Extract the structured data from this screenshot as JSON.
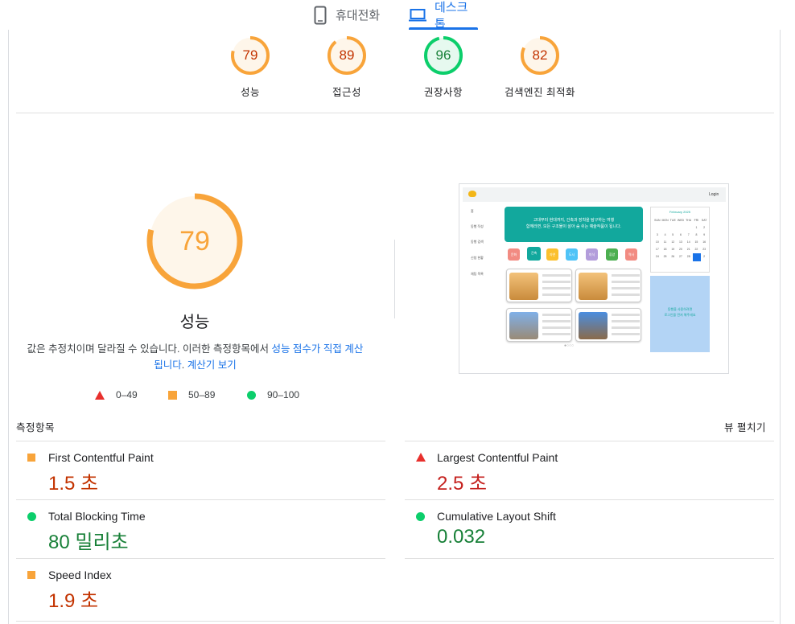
{
  "tabs": {
    "mobile": {
      "label": "휴대전화",
      "icon": "smartphone-icon"
    },
    "desktop": {
      "label": "데스크톱",
      "icon": "laptop-icon",
      "active": true
    }
  },
  "colors": {
    "accent": "#1a73e8",
    "average": "#f8a43a",
    "average_text": "#c33300",
    "pass": "#0cce6b",
    "pass_text": "#188038",
    "fail": "#e8302d",
    "fail_text": "#c5221f"
  },
  "gauges": [
    {
      "score": "79",
      "label": "성능",
      "status": "average"
    },
    {
      "score": "89",
      "label": "접근성",
      "status": "average"
    },
    {
      "score": "96",
      "label": "권장사항",
      "status": "pass"
    },
    {
      "score": "82",
      "label": "검색엔진 최적화",
      "status": "average"
    }
  ],
  "performance": {
    "score": "79",
    "title": "성능",
    "desc_prefix": "값은 추정치이며 달라질 수 있습니다. 이러한 측정항목에서 ",
    "desc_link1": "성능 점수가 직접 계산됩니다",
    "desc_mid": ". ",
    "desc_link2": "계산기 보기"
  },
  "legend": [
    {
      "shape": "triangle",
      "range": "0–49"
    },
    {
      "shape": "square",
      "range": "50–89"
    },
    {
      "shape": "circle",
      "range": "90–100"
    }
  ],
  "screenshot": {
    "login": "Login",
    "side_items": [
      "홈",
      "동행 작성",
      "동행 검색",
      "신청 현황",
      "채팅 목록"
    ],
    "hero_line1": "고대부터 현대까지, 건축과 장착을 탐구하는 여행",
    "hero_line2": "함께라면, 모든 구조물이 살아 숨 쉬는 예술작품이 됩니다.",
    "chips": [
      "문화",
      "건축",
      "자연",
      "도시",
      "미식",
      "휴양",
      "역사"
    ],
    "calendar_title": "February 2025",
    "calendar_days": [
      "SUN",
      "MON",
      "TUE",
      "WED",
      "THU",
      "FRI",
      "SAT",
      "",
      "",
      "",
      "",
      "",
      "1",
      "2",
      "3",
      "4",
      "5",
      "6",
      "7",
      "8",
      "9",
      "10",
      "11",
      "12",
      "13",
      "14",
      "15",
      "16",
      "17",
      "18",
      "19",
      "20",
      "21",
      "22",
      "23",
      "24",
      "25",
      "26",
      "27",
      "28",
      "1",
      "2"
    ],
    "ad_line1": "동행을 사용하려면",
    "ad_line2": "로그인을 먼저 해주세요"
  },
  "metrics": {
    "header": "측정항목",
    "expand": "뷰 펼치기",
    "items": [
      {
        "name": "First Contentful Paint",
        "value": "1.5 초",
        "status": "average"
      },
      {
        "name": "Largest Contentful Paint",
        "value": "2.5 초",
        "status": "fail"
      },
      {
        "name": "Total Blocking Time",
        "value": "80 밀리초",
        "status": "pass"
      },
      {
        "name": "Cumulative Layout Shift",
        "value": "0.032",
        "status": "pass"
      },
      {
        "name": "Speed Index",
        "value": "1.9 초",
        "status": "average"
      }
    ]
  }
}
